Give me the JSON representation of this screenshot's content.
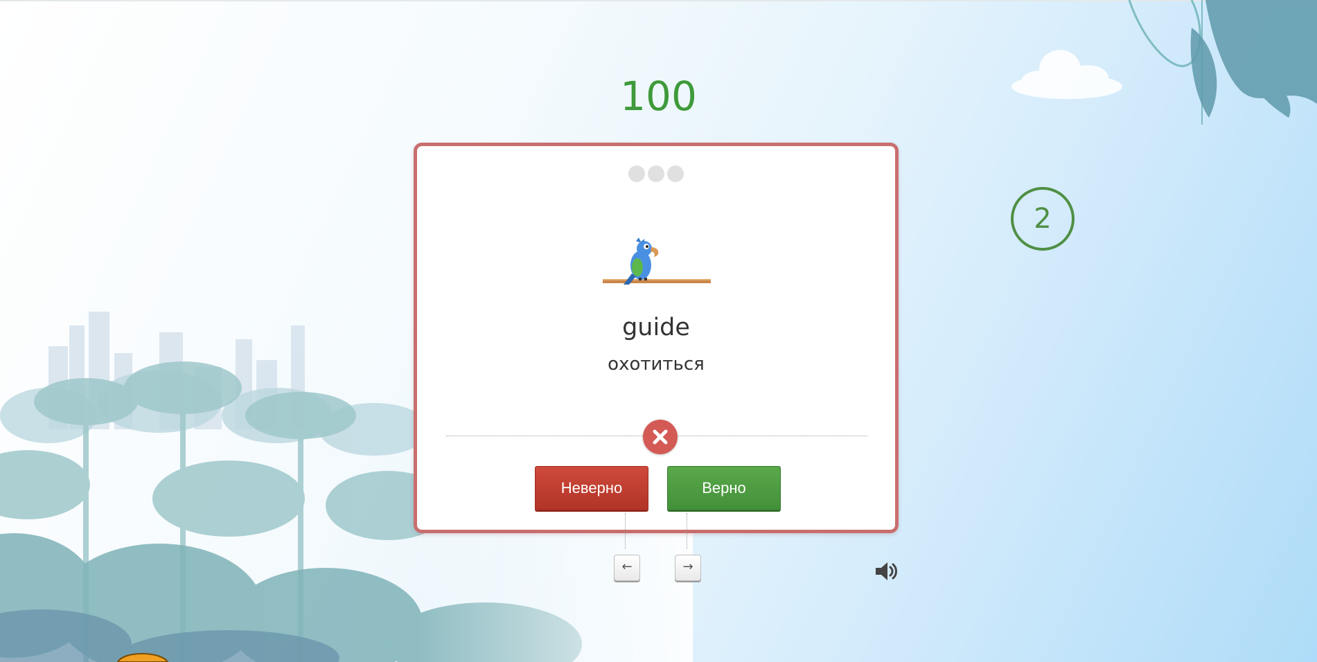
{
  "game": {
    "score": "100",
    "progress_dots": [
      {
        "state": "empty"
      },
      {
        "state": "empty"
      },
      {
        "state": "empty"
      }
    ],
    "card": {
      "word": "guide",
      "translation": "охотиться",
      "result_icon": "close-icon",
      "border_color": "#c96e6e"
    },
    "buttons": {
      "wrong_label": "Неверно",
      "right_label": "Верно"
    },
    "keys": {
      "left": "←",
      "right": "→"
    },
    "timer": "2",
    "sound_icon": "speaker-icon"
  },
  "colors": {
    "score": "#3e9a3a",
    "wrong_button": "#c0392b",
    "right_button": "#4a9a3f",
    "timer": "#4f8f44",
    "result_badge": "#d45a55"
  }
}
